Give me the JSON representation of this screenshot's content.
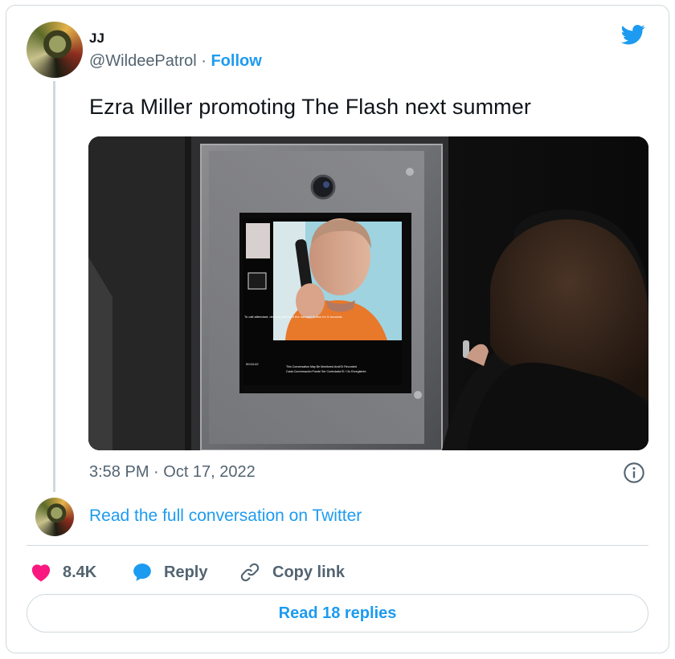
{
  "author": {
    "name": "JJ",
    "handle": "@WildeePatrol",
    "separator": " · ",
    "follow_label": "Follow"
  },
  "tweet": {
    "text": "Ezra Miller promoting The Flash next summer",
    "timestamp": "3:58 PM · Oct 17, 2022"
  },
  "media": {
    "screen_small_text_1": "To call attendant, depress and hold the handset button for 5 seconds.",
    "screen_small_text_2": "This Conversation May Be Monitored And/Or Recorded",
    "screen_small_text_3": "Cada Conversación Puede Ser Controlada El / Ou Enregistrée",
    "screen_clock": "00:04:42"
  },
  "conversation_link": "Read the full conversation on Twitter",
  "actions": {
    "likes": "8.4K",
    "reply_label": "Reply",
    "copy_label": "Copy link"
  },
  "replies_button": "Read 18 replies",
  "colors": {
    "accent": "#1d9bf0",
    "like": "#f91880",
    "muted": "#536471",
    "border": "#cfd9de"
  },
  "icons": [
    "twitter-bird-icon",
    "info-icon",
    "heart-icon",
    "reply-bubble-icon",
    "link-icon"
  ]
}
